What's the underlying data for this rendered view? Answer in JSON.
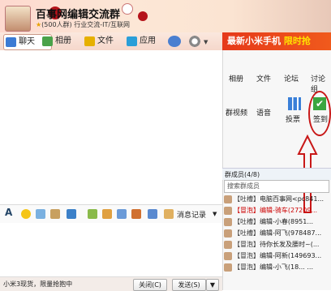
{
  "header": {
    "title": "百事网编辑交流群",
    "members_badge": "(500人群)",
    "category": "行业交流-IT/互联网"
  },
  "tabs": [
    {
      "label": "聊天"
    },
    {
      "label": "相册"
    },
    {
      "label": "文件"
    },
    {
      "label": "应用"
    }
  ],
  "ad": {
    "text": "最新小米手机 ",
    "highlight": "限时抢"
  },
  "apps_row1": [
    "相册",
    "文件",
    "论坛",
    "讨论组"
  ],
  "apps_row2": [
    "群视频",
    "语音",
    "投票",
    "签到"
  ],
  "toolbar": {
    "message_log": "消息记录"
  },
  "bottom": {
    "tip": "小米3现货，限量抢抱中",
    "close": "关闭(C)",
    "send": "发送(S)"
  },
  "members": {
    "header": "群成员(4/8)",
    "search_placeholder": "搜索群成员",
    "list": [
      {
        "tag": "【吐槽】",
        "name": "电脑百事网<pc841..."
      },
      {
        "tag": "【冒泡】",
        "name": "编辑-骑车(27209..."
      },
      {
        "tag": "【吐槽】",
        "name": "编辑-小春(8951..."
      },
      {
        "tag": "【吐槽】",
        "name": "编辑-阿飞(978487..."
      },
      {
        "tag": "【冒泡】",
        "name": "待你长发及腰时~(..."
      },
      {
        "tag": "【冒泡】",
        "name": "编辑-阿新(149693..."
      },
      {
        "tag": "【冒泡】",
        "name": "编辑-小飞(18... ..."
      }
    ]
  }
}
